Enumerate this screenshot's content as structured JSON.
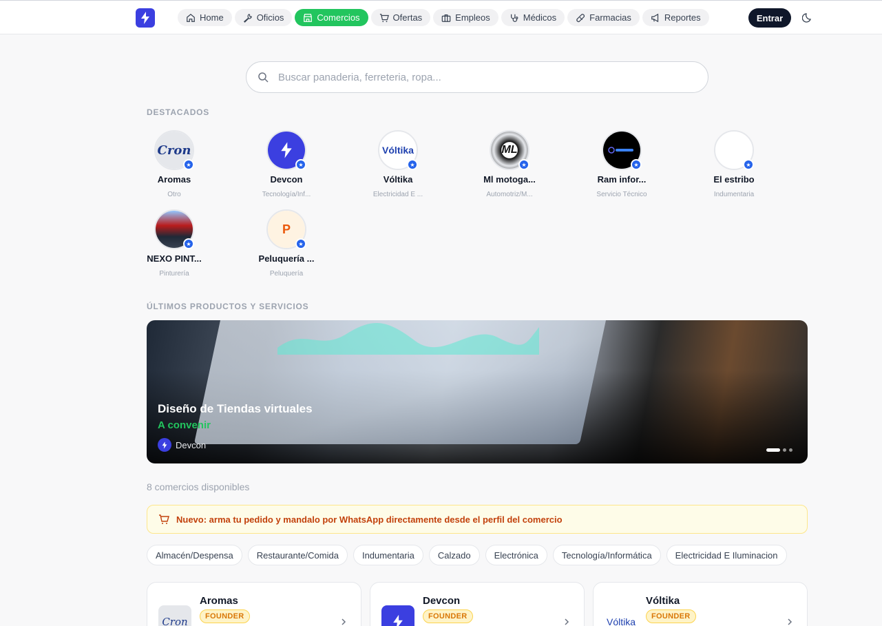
{
  "nav": {
    "items": [
      {
        "label": "Home",
        "icon": "home-icon"
      },
      {
        "label": "Oficios",
        "icon": "wrench-icon"
      },
      {
        "label": "Comercios",
        "icon": "store-icon",
        "active": true
      },
      {
        "label": "Ofertas",
        "icon": "cart-icon"
      },
      {
        "label": "Empleos",
        "icon": "briefcase-icon"
      },
      {
        "label": "Médicos",
        "icon": "stethoscope-icon"
      },
      {
        "label": "Farmacias",
        "icon": "pill-icon"
      },
      {
        "label": "Reportes",
        "icon": "megaphone-icon"
      }
    ],
    "login_label": "Entrar",
    "accent": "#22c55e"
  },
  "search": {
    "placeholder": "Buscar panaderia, ferreteria, ropa..."
  },
  "featured": {
    "title": "DESTACADOS",
    "items": [
      {
        "name": "Aromas",
        "category": "Otro"
      },
      {
        "name": "Devcon",
        "category": "Tecnología/Inf..."
      },
      {
        "name": "Vóltika",
        "category": "Electricidad E ..."
      },
      {
        "name": "Ml motoga...",
        "category": "Automotriz/M..."
      },
      {
        "name": "Ram infor...",
        "category": "Servicio Técnico"
      },
      {
        "name": "El estribo",
        "category": "Indumentaria"
      },
      {
        "name": "NEXO PINT...",
        "category": "Pinturería"
      },
      {
        "name": "Peluquería ...",
        "category": "Peluquería",
        "initial": "P"
      }
    ]
  },
  "latest": {
    "title": "ÚLTIMOS PRODUCTOS Y SERVICIOS",
    "banner": {
      "title": "Diseño de Tiendas virtuales",
      "price": "A convenir",
      "owner": "Devcon"
    }
  },
  "count_text": "8 comercios disponibles",
  "notice": {
    "text": "Nuevo: arma tu pedido y mandalo por WhatsApp directamente desde el perfil del comercio"
  },
  "categories": [
    "Almacén/Despensa",
    "Restaurante/Comida",
    "Indumentaria",
    "Calzado",
    "Electrónica",
    "Tecnología/Informática",
    "Electricidad E Iluminacion"
  ],
  "businesses": [
    {
      "name": "Aromas",
      "badge": "FOUNDER"
    },
    {
      "name": "Devcon",
      "badge": "FOUNDER"
    },
    {
      "name": "Vóltika",
      "badge": "FOUNDER"
    }
  ]
}
